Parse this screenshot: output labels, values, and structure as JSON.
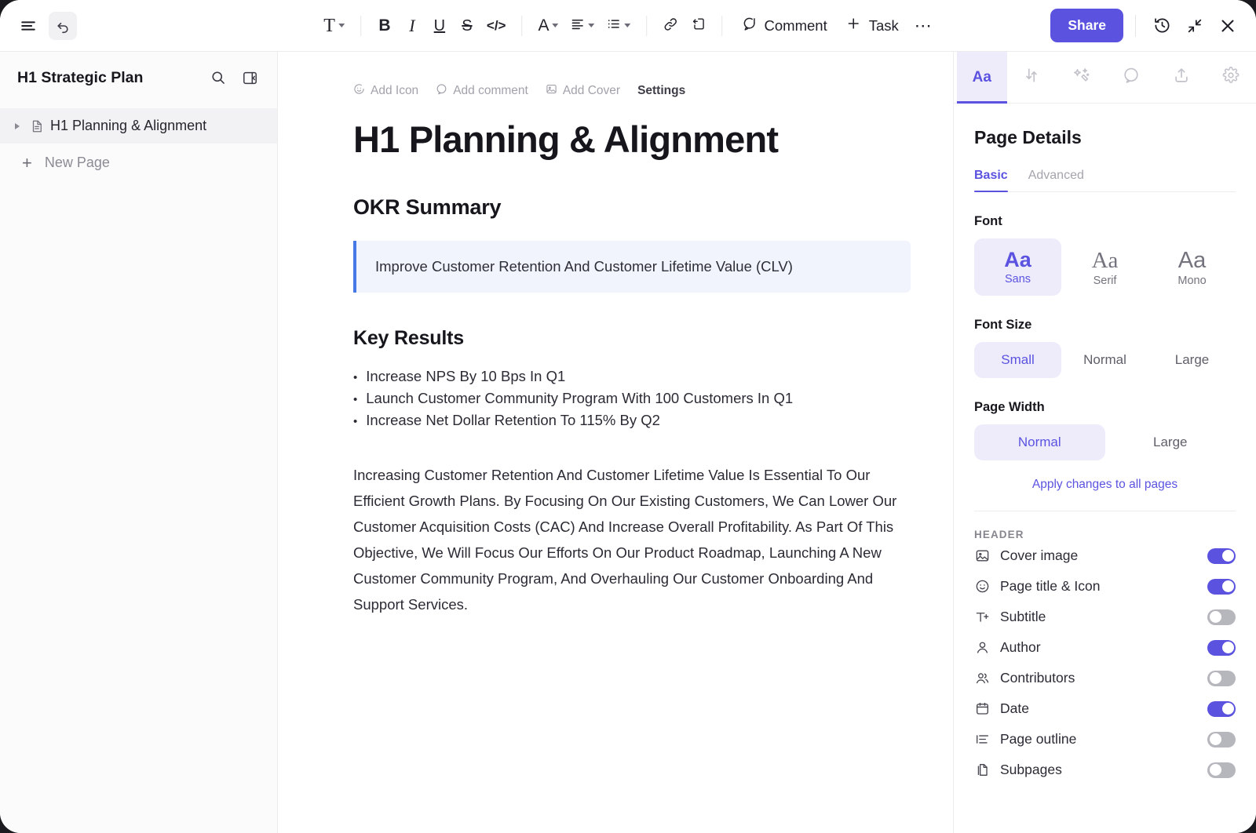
{
  "toolbar": {
    "menu_icon": "hamburger-menu-icon",
    "undo_icon": "undo-arrow-icon",
    "text_style_icon": "T",
    "bold_icon": "B",
    "italic_icon": "I",
    "underline_icon": "U",
    "strikethrough_icon": "S",
    "code_icon": "</>",
    "color_icon": "A",
    "align_icon": "align-left-icon",
    "list_icon": "bullet-list-icon",
    "link_icon": "link-icon",
    "page_link_icon": "page-link-icon",
    "comment_label": "Comment",
    "task_label": "Task",
    "more_label": "⋯",
    "share_label": "Share",
    "history_icon": "history-clock-icon",
    "collapse_icon": "collapse-arrows-icon",
    "close_icon": "close-x-icon"
  },
  "sidebar": {
    "title": "H1 Strategic Plan",
    "search_icon": "search-icon",
    "collapse_icon": "panel-collapse-icon",
    "items": [
      {
        "label": "H1 Planning & Alignment",
        "icon": "document-icon",
        "active": true
      }
    ],
    "new_page_label": "New Page"
  },
  "document": {
    "actions": [
      {
        "label": "Add Icon",
        "icon": "emoji-icon",
        "active": false
      },
      {
        "label": "Add comment",
        "icon": "comment-icon",
        "active": false
      },
      {
        "label": "Add Cover",
        "icon": "image-icon",
        "active": false
      },
      {
        "label": "Settings",
        "icon": "",
        "active": true
      }
    ],
    "title": "H1 Planning & Alignment",
    "okr_heading": "OKR Summary",
    "callout": "Improve Customer Retention And Customer Lifetime Value (CLV)",
    "key_results_heading": "Key Results",
    "key_results": [
      "Increase NPS By 10 Bps In Q1",
      "Launch Customer Community Program With 100 Customers In Q1",
      "Increase Net Dollar Retention To 115% By Q2"
    ],
    "paragraph": "Increasing Customer Retention And Customer Lifetime Value Is Essential To Our Efficient Growth Plans. By Focusing On Our Existing Customers, We Can Lower Our Customer Acquisition Costs (CAC) And Increase Overall Profitability. As Part Of This Objective, We Will Focus Our Efforts On Our Product Roadmap, Launching A New Customer Community Program, And Overhauling Our Customer Onboarding And Support Services."
  },
  "panel": {
    "tabs": [
      {
        "name": "typography",
        "label": "Aa",
        "icon": "aa-icon",
        "active": true
      },
      {
        "name": "relationships",
        "label": "",
        "icon": "relationship-arrows-icon",
        "active": false
      },
      {
        "name": "ai",
        "label": "",
        "icon": "ai-sparkle-icon",
        "active": false
      },
      {
        "name": "comments",
        "label": "",
        "icon": "comment-bubble-icon",
        "active": false
      },
      {
        "name": "export",
        "label": "",
        "icon": "upload-share-icon",
        "active": false
      },
      {
        "name": "settings",
        "label": "",
        "icon": "gear-icon",
        "active": false
      }
    ],
    "heading": "Page Details",
    "subtabs": [
      {
        "label": "Basic",
        "active": true
      },
      {
        "label": "Advanced",
        "active": false
      }
    ],
    "font_label": "Font",
    "font_options": [
      {
        "glyph": "Aa",
        "label": "Sans",
        "active": true
      },
      {
        "glyph": "Aa",
        "label": "Serif",
        "active": false
      },
      {
        "glyph": "Aa",
        "label": "Mono",
        "active": false
      }
    ],
    "font_size_label": "Font Size",
    "font_size_options": [
      {
        "label": "Small",
        "active": true
      },
      {
        "label": "Normal",
        "active": false
      },
      {
        "label": "Large",
        "active": false
      }
    ],
    "page_width_label": "Page Width",
    "page_width_options": [
      {
        "label": "Normal",
        "active": true
      },
      {
        "label": "Large",
        "active": false
      }
    ],
    "apply_label": "Apply changes to all pages",
    "header_section_label": "HEADER",
    "header_toggles": [
      {
        "label": "Cover image",
        "icon": "image-icon",
        "on": true
      },
      {
        "label": "Page title & Icon",
        "icon": "smiley-icon",
        "on": true
      },
      {
        "label": "Subtitle",
        "icon": "text-add-icon",
        "on": false
      },
      {
        "label": "Author",
        "icon": "person-icon",
        "on": true
      },
      {
        "label": "Contributors",
        "icon": "people-icon",
        "on": false
      },
      {
        "label": "Date",
        "icon": "calendar-icon",
        "on": true
      },
      {
        "label": "Page outline",
        "icon": "outline-list-icon",
        "on": false
      },
      {
        "label": "Subpages",
        "icon": "subpages-icon",
        "on": false
      }
    ]
  },
  "colors": {
    "accent": "#5b53e0",
    "accent_soft": "#eeecfb",
    "callout_bg": "#f1f4fd",
    "callout_border": "#4678e6",
    "toggle_off": "#b6b6bd"
  }
}
